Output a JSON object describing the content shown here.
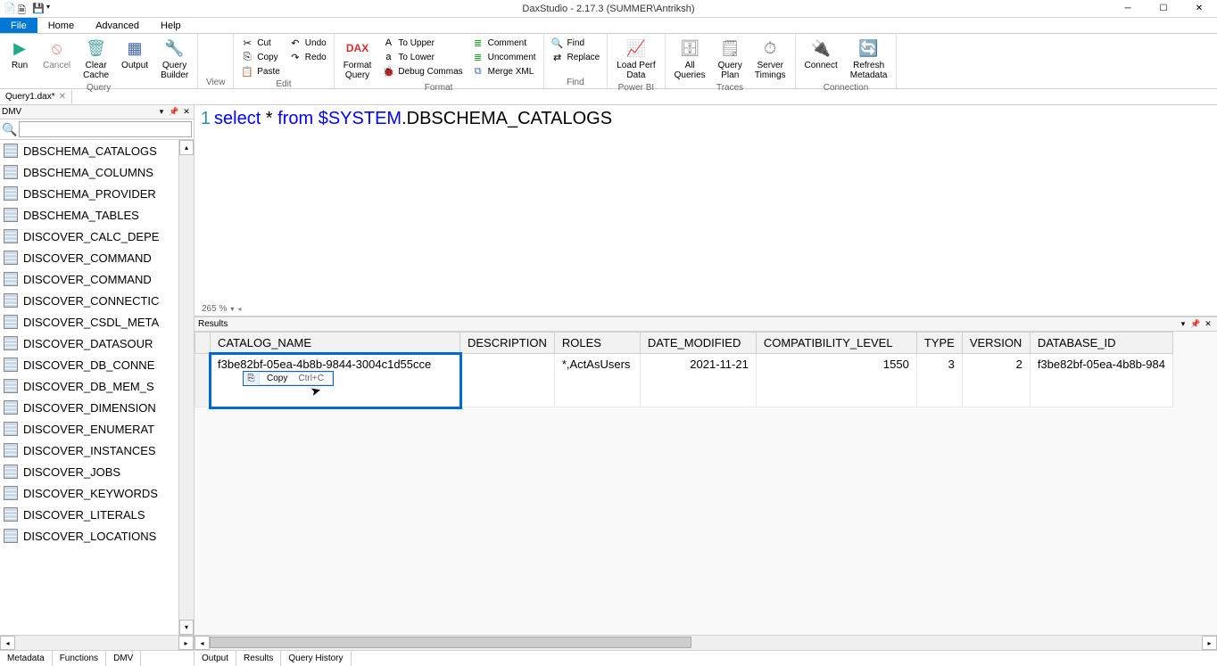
{
  "app": {
    "title": "DaxStudio - 2.17.3 (SUMMER\\Antriksh)"
  },
  "menu": {
    "file": "File",
    "home": "Home",
    "advanced": "Advanced",
    "help": "Help"
  },
  "ribbon": {
    "query": {
      "label": "Query",
      "run": "Run",
      "cancel": "Cancel",
      "clear_cache": "Clear\nCache",
      "output": "Output",
      "query_builder": "Query\nBuilder"
    },
    "view": {
      "label": "View"
    },
    "edit": {
      "label": "Edit",
      "cut": "Cut",
      "copy": "Copy",
      "paste": "Paste",
      "undo": "Undo",
      "redo": "Redo"
    },
    "format": {
      "label": "Format",
      "format_query": "Format\nQuery",
      "to_upper": "To Upper",
      "to_lower": "To Lower",
      "debug_commas": "Debug Commas",
      "comment": "Comment",
      "uncomment": "Uncomment",
      "merge_xml": "Merge XML"
    },
    "find": {
      "label": "Find",
      "find": "Find",
      "replace": "Replace"
    },
    "powerbi": {
      "label": "Power BI",
      "load_perf": "Load Perf\nData"
    },
    "traces": {
      "label": "Traces",
      "all_queries": "All\nQueries",
      "query_plan": "Query\nPlan",
      "server_timings": "Server\nTimings"
    },
    "connection": {
      "label": "Connection",
      "connect": "Connect",
      "refresh_metadata": "Refresh\nMetadata"
    }
  },
  "doc_tab": {
    "name": "Query1.dax*"
  },
  "dmv": {
    "title": "DMV",
    "search_placeholder": "",
    "items": [
      "DBSCHEMA_CATALOGS",
      "DBSCHEMA_COLUMNS",
      "DBSCHEMA_PROVIDER",
      "DBSCHEMA_TABLES",
      "DISCOVER_CALC_DEPE",
      "DISCOVER_COMMAND",
      "DISCOVER_COMMAND",
      "DISCOVER_CONNECTIC",
      "DISCOVER_CSDL_META",
      "DISCOVER_DATASOUR",
      "DISCOVER_DB_CONNE",
      "DISCOVER_DB_MEM_S",
      "DISCOVER_DIMENSION",
      "DISCOVER_ENUMERAT",
      "DISCOVER_INSTANCES",
      "DISCOVER_JOBS",
      "DISCOVER_KEYWORDS",
      "DISCOVER_LITERALS",
      "DISCOVER_LOCATIONS"
    ]
  },
  "dmv_tabs": {
    "metadata": "Metadata",
    "functions": "Functions",
    "dmv": "DMV"
  },
  "editor": {
    "line_number": "1",
    "code_kw": "select",
    "code_star": " * ",
    "code_from": "from ",
    "code_sys": "$SYSTEM",
    "code_tbl": ".DBSCHEMA_CATALOGS",
    "zoom": "265 %"
  },
  "results": {
    "title": "Results",
    "columns": [
      "CATALOG_NAME",
      "DESCRIPTION",
      "ROLES",
      "DATE_MODIFIED",
      "COMPATIBILITY_LEVEL",
      "TYPE",
      "VERSION",
      "DATABASE_ID"
    ],
    "row": {
      "catalog_name": "f3be82bf-05ea-4b8b-9844-3004c1d55cce",
      "description": "",
      "roles": "*,ActAsUsers",
      "date_modified": "2021-11-21",
      "compat_level": "1550",
      "type": "3",
      "version": "2",
      "database_id": "f3be82bf-05ea-4b8b-984"
    }
  },
  "ctx": {
    "copy": "Copy",
    "shortcut": "Ctrl+C"
  },
  "output_tabs": {
    "output": "Output",
    "results": "Results",
    "query_history": "Query History"
  }
}
